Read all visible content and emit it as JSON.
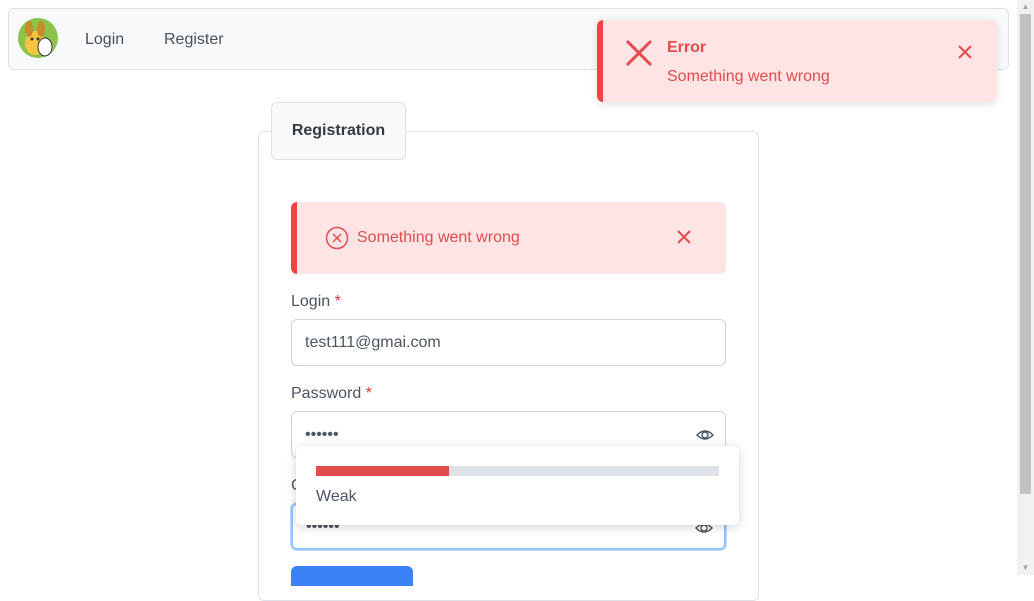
{
  "nav": {
    "login": "Login",
    "register": "Register"
  },
  "card": {
    "tab_label": "Registration"
  },
  "inline_error": {
    "text": "Something went wrong"
  },
  "form": {
    "login_label": "Login",
    "login_value": "test111@gmai.com",
    "password_label": "Password",
    "password_value": "••••••",
    "confirm_value": "••••••",
    "required_mark": "*"
  },
  "strength": {
    "label": "Weak",
    "level": 0.33
  },
  "toast": {
    "title": "Error",
    "detail": "Something went wrong"
  },
  "colors": {
    "error": "#e24c4c",
    "error_bg": "#ffe4e6",
    "primary": "#3b82f6"
  }
}
